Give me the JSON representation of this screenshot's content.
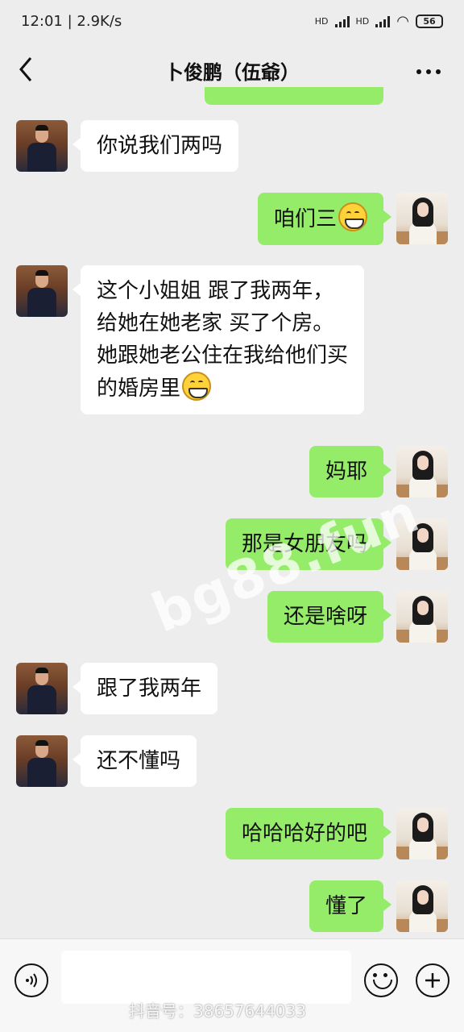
{
  "status_bar": {
    "time": "12:01",
    "speed": "2.9K/s",
    "network_1": "HD",
    "network_2": "HD",
    "battery": "56"
  },
  "header": {
    "back_icon": "chevron-left-icon",
    "title": "卜俊鹏（伍爺）",
    "more_icon": "more-dots-icon"
  },
  "messages": [
    {
      "side": "left",
      "text": "你说我们两吗",
      "avatar": "male"
    },
    {
      "side": "right",
      "text": "咱们三",
      "emoji": "grin-emoji",
      "avatar": "female"
    },
    {
      "side": "left",
      "text": "这个小姐姐 跟了我两年，\n给她在她老家 买了个房。\n她跟她老公住在我给他们买\n的婚房里",
      "emoji": "grin-emoji",
      "avatar": "male"
    },
    {
      "side": "right",
      "text": "妈耶",
      "avatar": "female"
    },
    {
      "side": "right",
      "text": "那是女朋友吗",
      "avatar": "female"
    },
    {
      "side": "right",
      "text": "还是啥呀",
      "avatar": "female"
    },
    {
      "side": "left",
      "text": "跟了我两年",
      "avatar": "male"
    },
    {
      "side": "left",
      "text": "还不懂吗",
      "avatar": "male"
    },
    {
      "side": "right",
      "text": "哈哈哈好的吧",
      "avatar": "female"
    },
    {
      "side": "right",
      "text": "懂了",
      "avatar": "female"
    }
  ],
  "watermark": "bg88.fun",
  "input_bar": {
    "voice_icon": "voice-icon",
    "input_value": "",
    "emoji_icon": "emoji-icon",
    "plus_icon": "plus-icon"
  },
  "douyin_watermark": "抖音号：38657644033"
}
